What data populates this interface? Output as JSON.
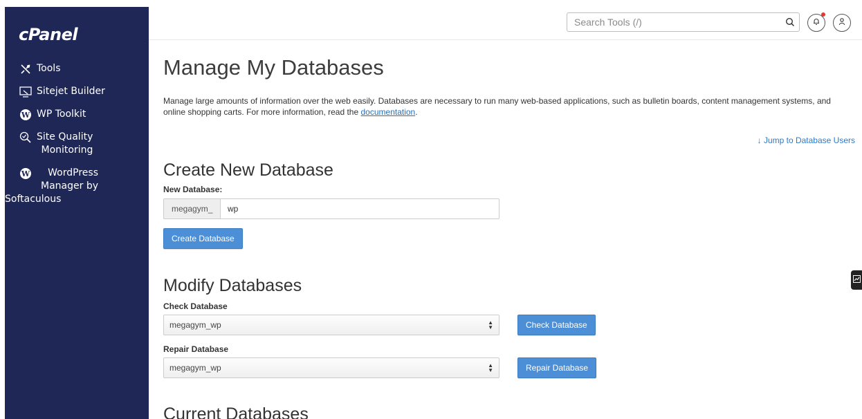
{
  "sidebar": {
    "logo": "cPanel",
    "items": [
      {
        "label": "Tools",
        "icon": "tools-icon"
      },
      {
        "label": "Sitejet Builder",
        "icon": "sitejet-icon"
      },
      {
        "label": "WP Toolkit",
        "icon": "wordpress-icon"
      },
      {
        "label_line1": "Site Quality",
        "label_line2": "Monitoring",
        "icon": "site-quality-icon"
      },
      {
        "label_line1": "WordPress",
        "label_line2": "Manager by",
        "label_line3": "Softaculous",
        "icon": "wordpress-icon"
      }
    ]
  },
  "header": {
    "search_placeholder": "Search Tools (/)",
    "notification_color": "#e53935"
  },
  "main": {
    "title": "Manage My Databases",
    "description": "Manage large amounts of information over the web easily. Databases are necessary to run many web-based applications, such as bulletin boards, content management systems, and online shopping carts. For more information, read the",
    "doc_link": "documentation",
    "description_end": ".",
    "jump_link": "Jump to Database Users",
    "create": {
      "heading": "Create New Database",
      "label": "New Database:",
      "prefix": "megagym_",
      "value": "wp",
      "button": "Create Database"
    },
    "modify": {
      "heading": "Modify Databases",
      "check_label": "Check Database",
      "check_value": "megagym_wp",
      "check_button": "Check Database",
      "repair_label": "Repair Database",
      "repair_value": "megagym_wp",
      "repair_button": "Repair Database"
    },
    "current_heading": "Current Databases"
  },
  "colors": {
    "sidebar_bg": "#1f2756",
    "primary_button": "#4d8fd6",
    "link": "#2a6fb3"
  }
}
